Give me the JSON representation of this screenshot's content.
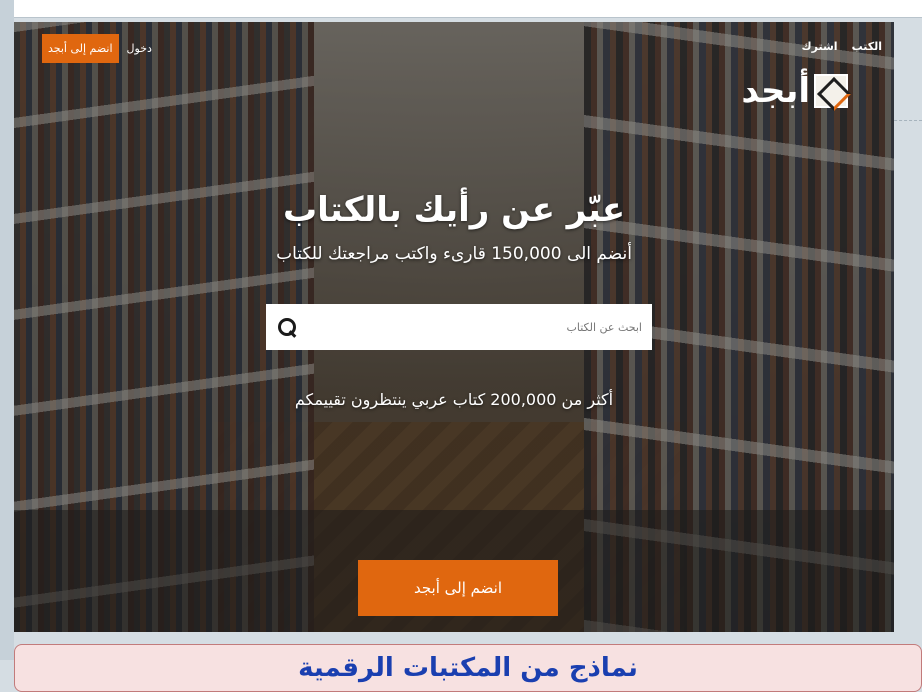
{
  "nav": {
    "books": "الكتب",
    "subscribe": "اشترك",
    "login": "دخول",
    "join_top": "انضم إلى أبجد"
  },
  "logo": {
    "text": "أبجد"
  },
  "hero": {
    "title": "عبّر عن رأيك بالكتاب",
    "subtitle": "أنضم الى 150,000 قارىء واكتب مراجعتك للكتاب",
    "search_placeholder": "ابحث عن الكتاب",
    "count_text": "أكثر من 200,000 كتاب عربي ينتظرون تقييمكم",
    "join_bottom": "انضم إلى أبجد"
  },
  "slide": {
    "caption": "نماذج من المكتبات الرقمية"
  },
  "colors": {
    "accent": "#e0670f",
    "caption_text": "#1a3fb0",
    "caption_bg": "#f7e1e1"
  },
  "icons": {
    "search": "search-icon",
    "logo": "abjad-logo-icon"
  }
}
